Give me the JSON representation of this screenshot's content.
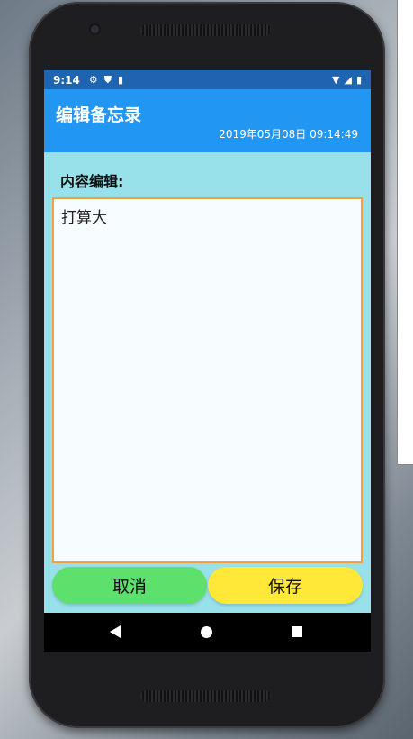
{
  "status_bar": {
    "time": "9:14",
    "icons_left": [
      "gear-icon",
      "shield-icon",
      "sd-card-icon"
    ],
    "icons_right": [
      "wifi-icon",
      "signal-icon",
      "battery-icon"
    ]
  },
  "app_bar": {
    "title": "编辑备忘录",
    "date": "2019年05月08日 09:14:49"
  },
  "editor": {
    "label": "内容编辑:",
    "value": "打算大"
  },
  "buttons": {
    "cancel": "取消",
    "save": "保存"
  },
  "colors": {
    "status_bar": "#1f64b0",
    "app_bar": "#2196f3",
    "background": "#98e0ea",
    "editor_border": "#f0a040",
    "cancel_button": "#5ee06c",
    "save_button": "#ffe838"
  },
  "nav_bar": {
    "icons": [
      "back-icon",
      "home-icon",
      "recents-icon"
    ]
  }
}
